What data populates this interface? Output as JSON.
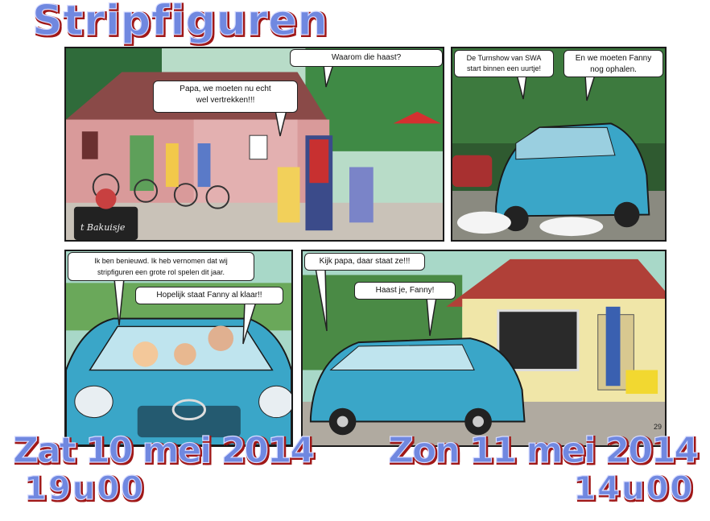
{
  "title": "Stripfiguren",
  "events": [
    {
      "date": "Zat 10 mei 2014",
      "time": "19u00"
    },
    {
      "date": "Zon 11 mei 2014",
      "time": "14u00"
    }
  ],
  "panels": [
    {
      "bubbles": [
        {
          "lines": [
            "Waarom die haast?"
          ]
        },
        {
          "lines": [
            "Papa, we moeten nu echt",
            "wel vertrekken!!!"
          ]
        }
      ],
      "sign": "t Bakuisje"
    },
    {
      "bubbles": [
        {
          "lines": [
            "De Turnshow van SWA",
            "start binnen een uurtje!"
          ]
        },
        {
          "lines": [
            "En we moeten Fanny",
            "nog ophalen."
          ]
        }
      ]
    },
    {
      "bubbles": [
        {
          "lines": [
            "Ik ben benieuwd. Ik heb vernomen dat wij",
            "stripfiguren een grote rol spelen dit jaar."
          ]
        },
        {
          "lines": [
            "Hopelijk staat Fanny al klaar!!"
          ]
        }
      ]
    },
    {
      "bubbles": [
        {
          "lines": [
            "Kijk papa, daar staat ze!!!"
          ]
        },
        {
          "lines": [
            "Haast je, Fanny!"
          ]
        }
      ],
      "page_number": "29"
    }
  ],
  "colors": {
    "car": "#3aa6c8",
    "title_fill": "#7088e0",
    "title_shadow": "#a01818"
  }
}
